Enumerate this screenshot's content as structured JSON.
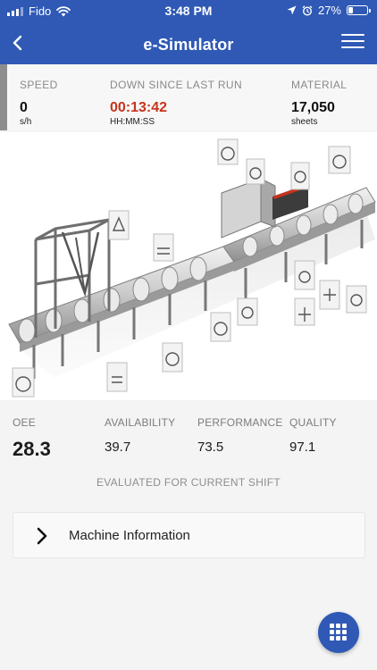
{
  "status_bar": {
    "carrier": "Fido",
    "time": "3:48 PM",
    "battery_percent": "27%",
    "battery_level": 0.27,
    "icons": [
      "signal-icon",
      "wifi-icon",
      "location-arrow-icon",
      "alarm-icon",
      "battery-icon"
    ]
  },
  "header": {
    "title": "e-Simulator",
    "back_icon": "chevron-left-icon",
    "menu_icon": "hamburger-menu-icon"
  },
  "metrics": {
    "speed": {
      "label": "SPEED",
      "value": "0",
      "unit": "s/h"
    },
    "downtime": {
      "label": "DOWN SINCE LAST RUN",
      "value": "00:13:42",
      "unit": "HH:MM:SS"
    },
    "material": {
      "label": "MATERIAL",
      "value": "17,050",
      "unit": "sheets"
    }
  },
  "kpis": {
    "oee": {
      "label": "OEE",
      "value": "28.3"
    },
    "availability": {
      "label": "AVAILABILITY",
      "value": "39.7"
    },
    "performance": {
      "label": "PERFORMANCE",
      "value": "73.5"
    },
    "quality": {
      "label": "QUALITY",
      "value": "97.1"
    },
    "note": "EVALUATED FOR CURRENT SHIFT"
  },
  "machine_info": {
    "label": "Machine Information",
    "icon": "chevron-right-icon"
  },
  "fab": {
    "icon": "grid-icon"
  },
  "colors": {
    "brand_blue": "#2f59b5",
    "alert_red": "#c8331c",
    "label_gray": "#8a8a8a",
    "accent_gray": "#8e8e8e"
  }
}
